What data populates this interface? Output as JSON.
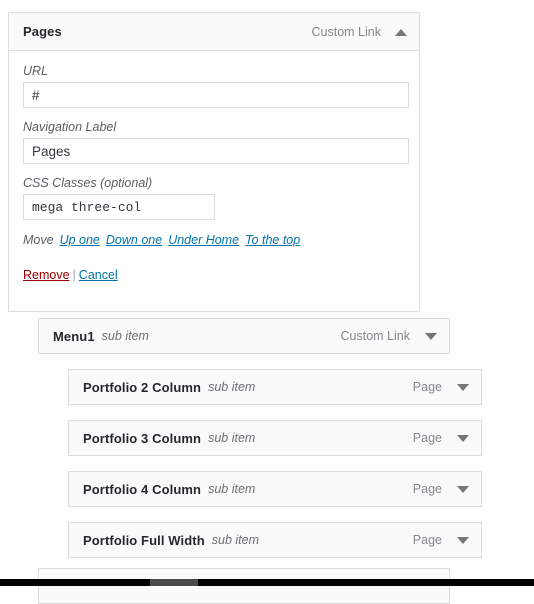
{
  "expanded_item": {
    "title": "Pages",
    "item_type": "Custom Link",
    "toggle_icon": "chevron-up-icon",
    "fields": {
      "url": {
        "label": "URL",
        "value": "#"
      },
      "navigation_label": {
        "label": "Navigation Label",
        "value": "Pages"
      },
      "css_classes": {
        "label": "CSS Classes (optional)",
        "value": "mega three-col"
      }
    },
    "move": {
      "label": "Move",
      "links": [
        "Up one",
        "Down one",
        "Under Home",
        "To the top"
      ]
    },
    "actions": {
      "remove": "Remove",
      "separator": "|",
      "cancel": "Cancel"
    }
  },
  "menu_rows": [
    {
      "title": "Menu1",
      "subtext": "sub item",
      "item_type": "Custom Link",
      "toggle_icon": "chevron-down-icon",
      "depth": 1
    },
    {
      "title": "Portfolio 2 Column",
      "subtext": "sub item",
      "item_type": "Page",
      "toggle_icon": "chevron-down-icon",
      "depth": 2
    },
    {
      "title": "Portfolio 3 Column",
      "subtext": "sub item",
      "item_type": "Page",
      "toggle_icon": "chevron-down-icon",
      "depth": 2
    },
    {
      "title": "Portfolio 4 Column",
      "subtext": "sub item",
      "item_type": "Page",
      "toggle_icon": "chevron-down-icon",
      "depth": 2
    },
    {
      "title": "Portfolio Full Width",
      "subtext": "sub item",
      "item_type": "Page",
      "toggle_icon": "chevron-down-icon",
      "depth": 2
    }
  ],
  "colors": {
    "link": "#0073aa",
    "remove": "#a00000",
    "row_background": "#fafafa",
    "border": "#dcdcdc",
    "muted_text": "#82878c"
  }
}
